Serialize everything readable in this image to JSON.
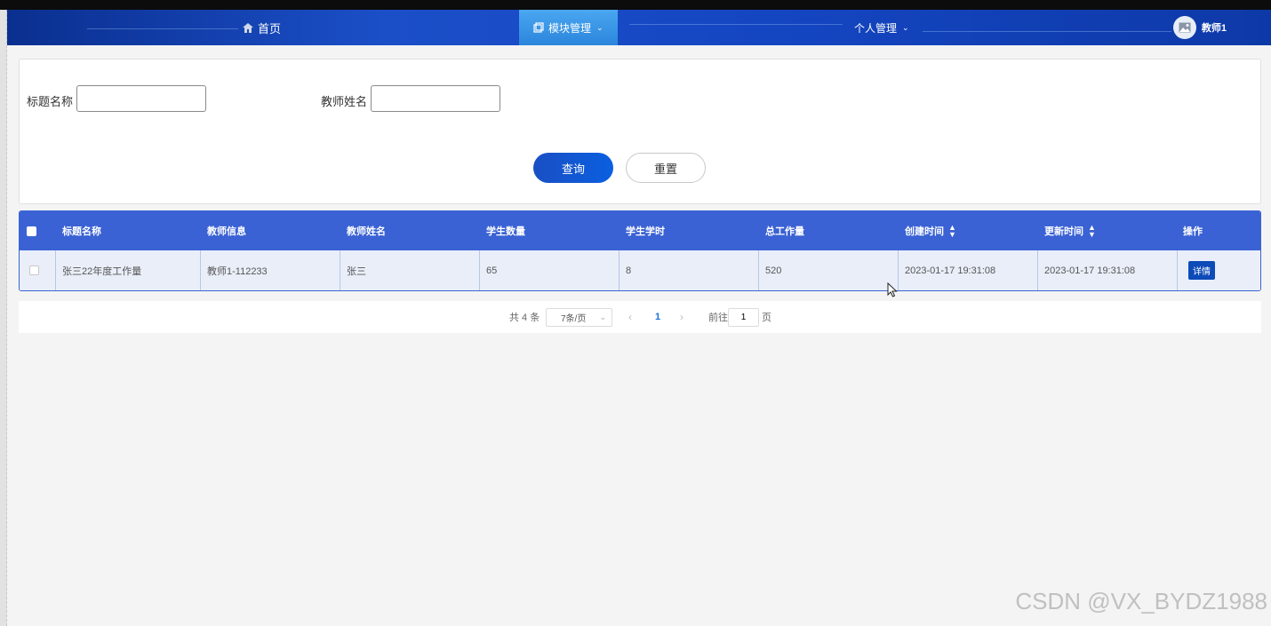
{
  "nav": {
    "home_label": "首页",
    "module_label": "模块管理",
    "personal_label": "个人管理",
    "user_name": "教师1"
  },
  "search": {
    "title_label": "标题名称",
    "title_value": "",
    "teacher_label": "教师姓名",
    "teacher_value": "",
    "query_label": "查询",
    "reset_label": "重置"
  },
  "table": {
    "headers": [
      "标题名称",
      "教师信息",
      "教师姓名",
      "学生数量",
      "学生学时",
      "总工作量",
      "创建时间",
      "更新时间",
      "操作"
    ],
    "rows": [
      {
        "title": "张三22年度工作量",
        "teacher_info": "教师1-112233",
        "teacher_name": "张三",
        "student_count": "65",
        "student_hours": "8",
        "total_workload": "520",
        "created": "2023-01-17 19:31:08",
        "updated": "2023-01-17 19:31:08",
        "action": "详情"
      }
    ]
  },
  "pagination": {
    "total": "共 4 条",
    "page_size": "7条/页",
    "current_page": "1",
    "goto_label": "前往",
    "goto_value": "1",
    "page_suffix": "页"
  },
  "watermark": "CSDN @VX_BYDZ1988",
  "colors": {
    "nav_bg": "#1546c2",
    "table_header": "#3a62d4",
    "primary_button": "#0a5fe0"
  }
}
